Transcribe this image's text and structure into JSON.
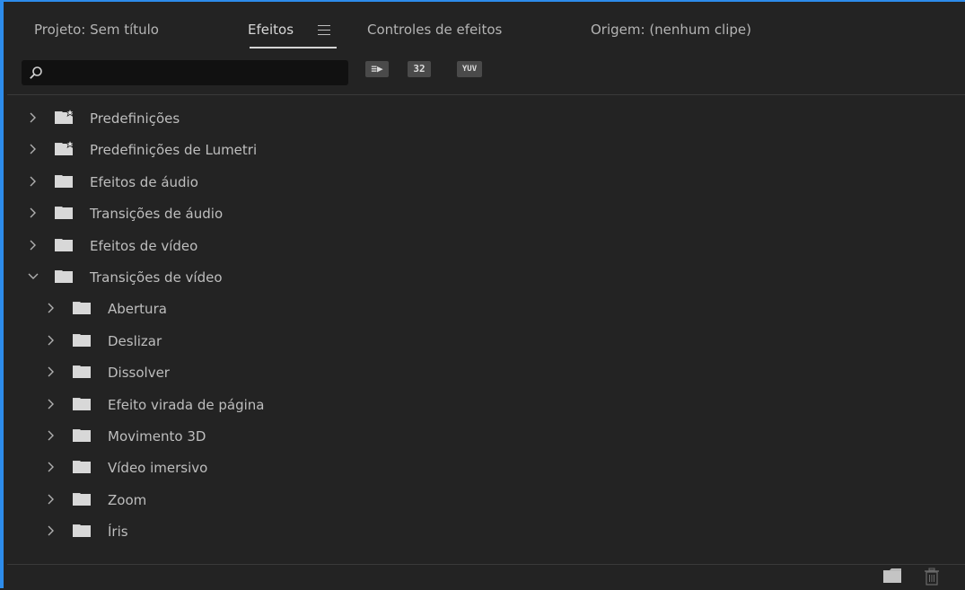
{
  "tabs": [
    {
      "label": "Projeto: Sem título"
    },
    {
      "label": "Efeitos"
    },
    {
      "label": "Controles de efeitos"
    },
    {
      "label": "Origem: (nenhum clipe)"
    }
  ],
  "search": {
    "value": "",
    "placeholder": ""
  },
  "filters": [
    {
      "label": "≡▶",
      "name": "accelerated-effects"
    },
    {
      "label": "32",
      "name": "32bit-color-effects"
    },
    {
      "label": "YUV",
      "name": "yuv-effects"
    }
  ],
  "tree": [
    {
      "label": "Predefinições",
      "expanded": false,
      "icon": "preset-folder-icon"
    },
    {
      "label": "Predefinições de Lumetri",
      "expanded": false,
      "icon": "preset-folder-icon"
    },
    {
      "label": "Efeitos de áudio",
      "expanded": false,
      "icon": "folder-icon"
    },
    {
      "label": "Transições de áudio",
      "expanded": false,
      "icon": "folder-icon"
    },
    {
      "label": "Efeitos de vídeo",
      "expanded": false,
      "icon": "folder-icon"
    },
    {
      "label": "Transições de vídeo",
      "expanded": true,
      "icon": "folder-icon"
    },
    {
      "label": "Abertura",
      "expanded": false,
      "icon": "folder-icon"
    },
    {
      "label": "Deslizar",
      "expanded": false,
      "icon": "folder-icon"
    },
    {
      "label": "Dissolver",
      "expanded": false,
      "icon": "folder-icon"
    },
    {
      "label": "Efeito virada de página",
      "expanded": false,
      "icon": "folder-icon"
    },
    {
      "label": "Movimento 3D",
      "expanded": false,
      "icon": "folder-icon"
    },
    {
      "label": "Vídeo imersivo",
      "expanded": false,
      "icon": "folder-icon"
    },
    {
      "label": "Zoom",
      "expanded": false,
      "icon": "folder-icon"
    },
    {
      "label": "Íris",
      "expanded": false,
      "icon": "folder-icon"
    }
  ],
  "bottom_bar": {
    "new_bin_icon": "new-folder-icon",
    "delete_icon": "trash-icon"
  },
  "colors": {
    "accent": "#2d8ceb",
    "background": "#232323",
    "text": "#bebebe"
  }
}
